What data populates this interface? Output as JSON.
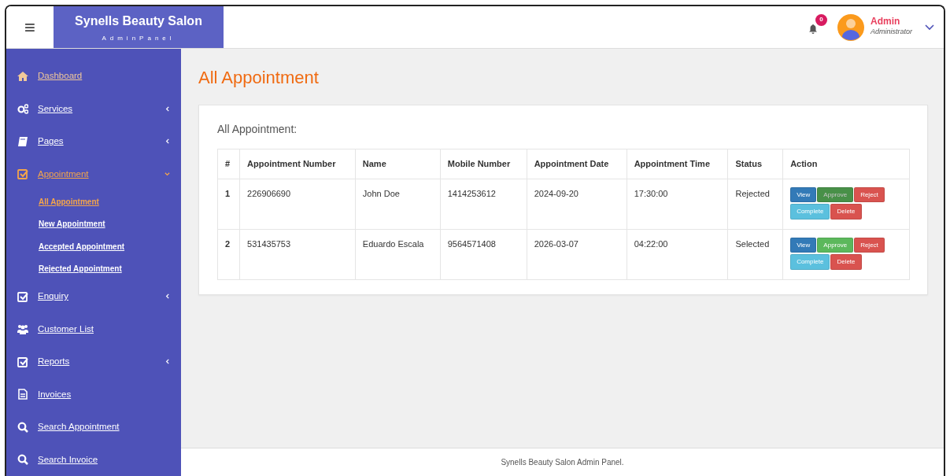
{
  "header": {
    "brand_title": "Synells Beauty Salon",
    "brand_subtitle": "AdminPanel",
    "menu_icon": "≡",
    "notifications": {
      "count": "0"
    },
    "user": {
      "name": "Admin",
      "role": "Administrator"
    }
  },
  "sidebar": {
    "items": [
      {
        "label": "Dashboard",
        "kind": "home",
        "highlighted": true,
        "selected": false
      },
      {
        "label": "Services",
        "kind": "gears",
        "highlighted": false,
        "selected": false,
        "expanded": false
      },
      {
        "label": "Pages",
        "kind": "book",
        "highlighted": false,
        "selected": false,
        "expanded": false
      },
      {
        "label": "Appointment",
        "kind": "check",
        "highlighted": false,
        "selected": true,
        "expanded": true,
        "children": [
          {
            "label": "All Appointment",
            "selected": true
          },
          {
            "label": "New Appointment",
            "selected": false
          },
          {
            "label": "Accepted Appointment",
            "selected": false
          },
          {
            "label": "Rejected Appointment",
            "selected": false
          }
        ]
      },
      {
        "label": "Enquiry",
        "kind": "check",
        "highlighted": false,
        "selected": false,
        "expanded": false
      },
      {
        "label": "Customer List",
        "kind": "users",
        "highlighted": false,
        "selected": false
      },
      {
        "label": "Reports",
        "kind": "check",
        "highlighted": false,
        "selected": false,
        "expanded": false
      },
      {
        "label": "Invoices",
        "kind": "file",
        "highlighted": false,
        "selected": false
      },
      {
        "label": "Search Appointment",
        "kind": "search",
        "highlighted": false,
        "selected": false
      },
      {
        "label": "Search Invoice",
        "kind": "search",
        "highlighted": false,
        "selected": false
      }
    ]
  },
  "page_title": "All Appointment",
  "panel": {
    "heading": "All Appointment:",
    "table": {
      "columns": [
        "#",
        "Appointment Number",
        "Name",
        "Mobile Number",
        "Appointment Date",
        "Appointment Time",
        "Status",
        "Action"
      ],
      "rows": [
        {
          "cells": [
            "1",
            "226906690",
            "John Doe",
            "1414253612",
            "2024-09-20",
            "17:30:00",
            "Rejected"
          ],
          "actions": [
            {
              "label": "View",
              "kind": "primary",
              "active": false
            },
            {
              "label": "Approve",
              "kind": "success",
              "active": true
            },
            {
              "label": "Reject",
              "kind": "danger",
              "active": false
            },
            {
              "label": "Complete",
              "kind": "info",
              "active": false
            },
            {
              "label": "Delete",
              "kind": "danger",
              "active": false
            }
          ]
        },
        {
          "cells": [
            "2",
            "531435753",
            "Eduardo Escala",
            "9564571408",
            "2026-03-07",
            "04:22:00",
            "Selected"
          ],
          "actions": [
            {
              "label": "View",
              "kind": "primary",
              "active": false
            },
            {
              "label": "Approve",
              "kind": "success",
              "active": false
            },
            {
              "label": "Reject",
              "kind": "danger",
              "active": false
            },
            {
              "label": "Complete",
              "kind": "info",
              "active": false
            },
            {
              "label": "Delete",
              "kind": "danger",
              "active": false
            }
          ]
        }
      ]
    }
  },
  "footer": "Synells Beauty Salon Admin Panel."
}
